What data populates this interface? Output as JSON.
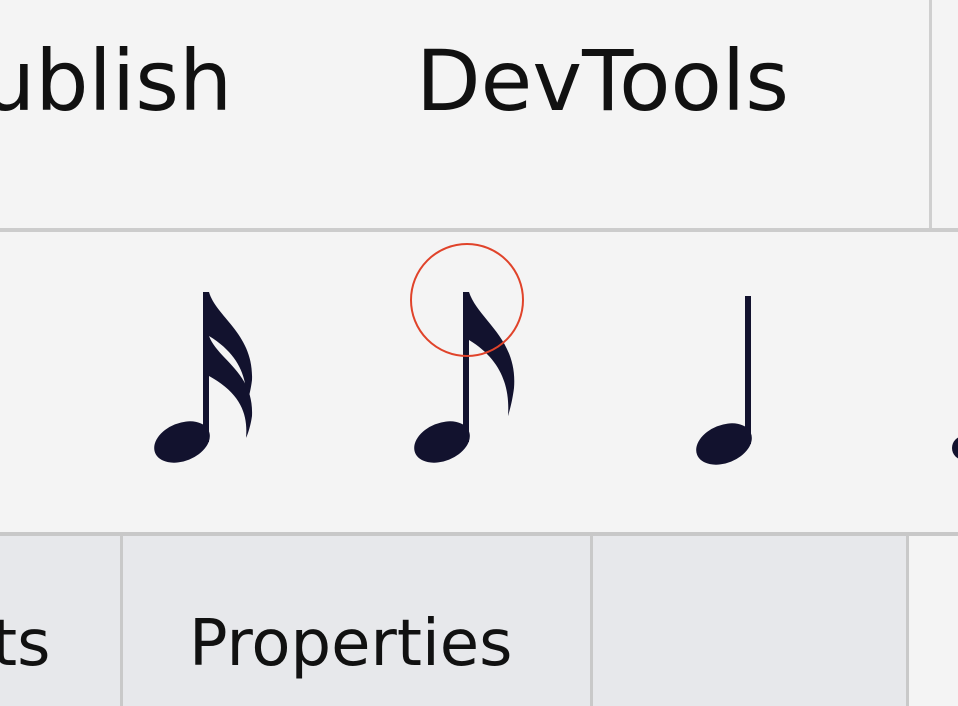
{
  "menu": {
    "items": [
      {
        "label": "ublish"
      },
      {
        "label": "DevTools"
      }
    ]
  },
  "note_toolbar": {
    "buttons": [
      {
        "icon": "sixteenth-note-icon"
      },
      {
        "icon": "eighth-note-icon",
        "focused": true
      },
      {
        "icon": "quarter-note-icon"
      }
    ],
    "colors": {
      "note": "#12122e",
      "focus_ring": "#e0432a"
    }
  },
  "tabs": {
    "items": [
      {
        "label": "ts"
      },
      {
        "label": "Properties"
      },
      {
        "label": ""
      }
    ]
  }
}
